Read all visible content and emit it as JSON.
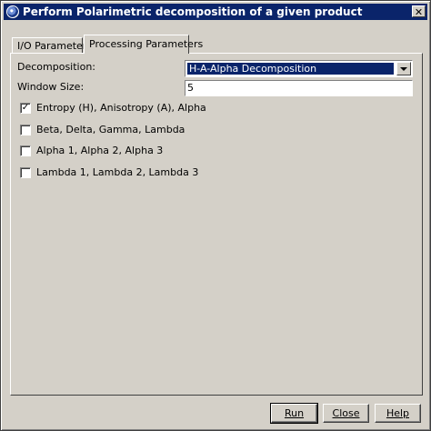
{
  "window": {
    "title": "Perform Polarimetric decomposition of a given product",
    "close_glyph": "✕",
    "icon": "app-globe-icon"
  },
  "tabs": [
    {
      "label": "I/O Parameters",
      "selected": false
    },
    {
      "label": "Processing Parameters",
      "selected": true
    }
  ],
  "form": {
    "decomposition_label": "Decomposition:",
    "decomposition_value": "H-A-Alpha Decomposition",
    "window_size_label": "Window Size:",
    "window_size_value": "5"
  },
  "checkboxes": [
    {
      "label": "Entropy (H), Anisotropy (A), Alpha",
      "checked": true
    },
    {
      "label": "Beta, Delta, Gamma, Lambda",
      "checked": false
    },
    {
      "label": "Alpha 1, Alpha 2, Alpha 3",
      "checked": false
    },
    {
      "label": "Lambda 1, Lambda 2, Lambda 3",
      "checked": false
    }
  ],
  "buttons": {
    "run": "Run",
    "close": "Close",
    "help": "Help"
  },
  "check_glyph": "✓"
}
